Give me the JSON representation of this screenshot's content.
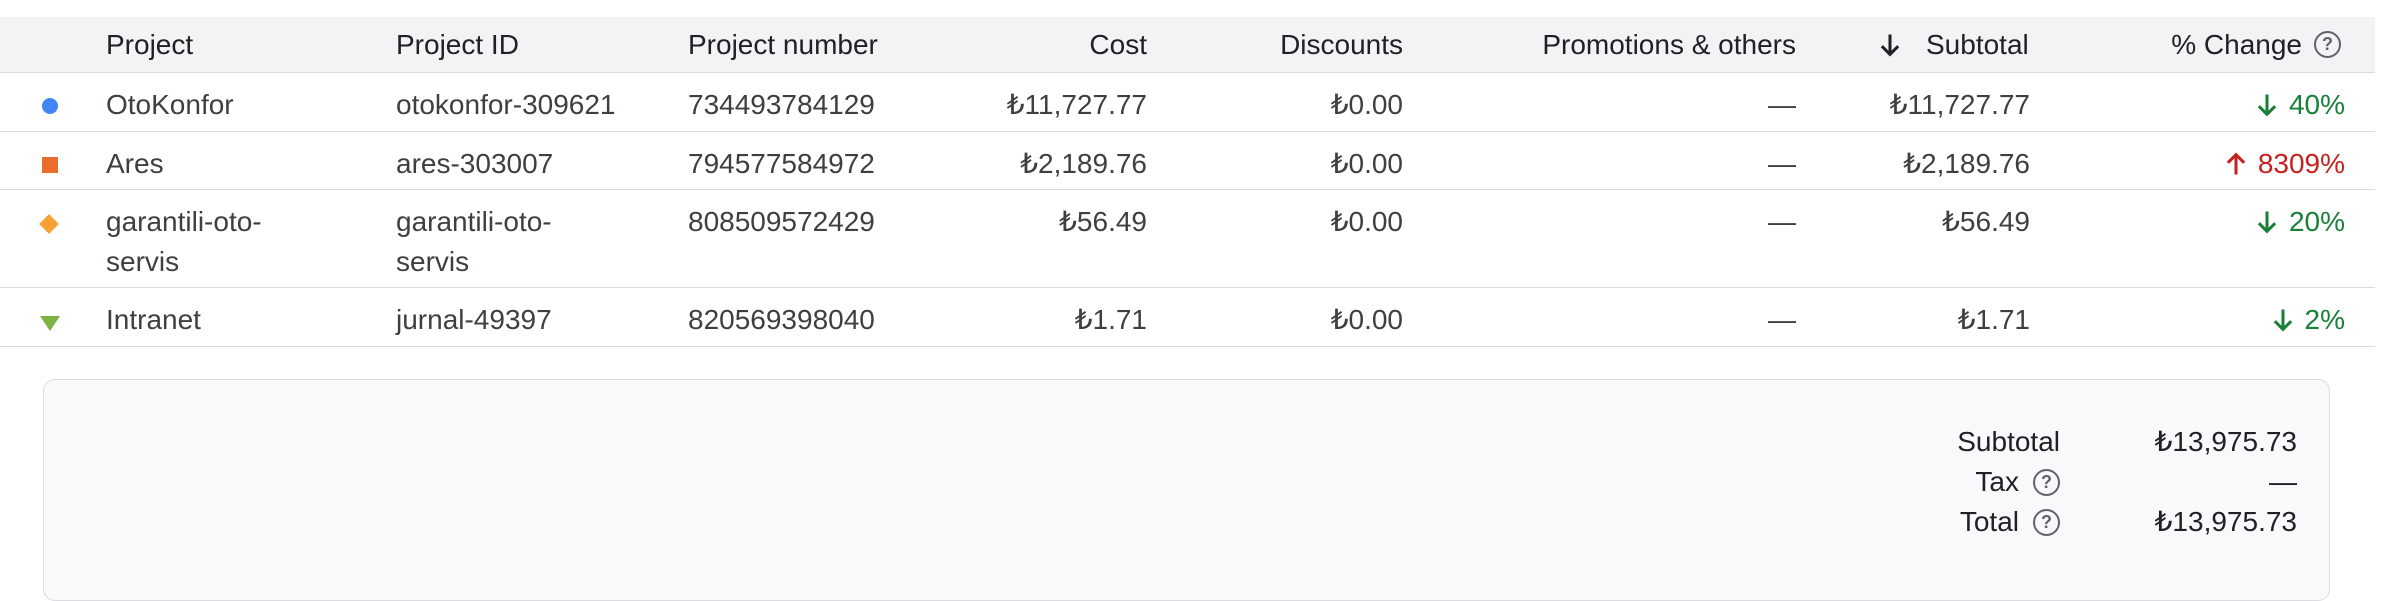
{
  "columns": {
    "project": "Project",
    "project_id": "Project ID",
    "project_number": "Project number",
    "cost": "Cost",
    "discounts": "Discounts",
    "promotions": "Promotions & others",
    "subtotal": "Subtotal",
    "change": "% Change"
  },
  "rows": [
    {
      "marker": "circle",
      "marker_color": "#4285f4",
      "project": "OtoKonfor",
      "project_id": "otokonfor-309621",
      "project_number": "734493784129",
      "cost": "₺11,727.77",
      "discounts": "₺0.00",
      "promotions": "—",
      "subtotal": "₺11,727.77",
      "change": "40%",
      "change_dir": "down",
      "change_color": "#188038"
    },
    {
      "marker": "square",
      "marker_color": "#ea6d2b",
      "project": "Ares",
      "project_id": "ares-303007",
      "project_number": "794577584972",
      "cost": "₺2,189.76",
      "discounts": "₺0.00",
      "promotions": "—",
      "subtotal": "₺2,189.76",
      "change": "8309%",
      "change_dir": "up",
      "change_color": "#c5221f"
    },
    {
      "marker": "diamond",
      "marker_color": "#f6a233",
      "project": "garantili-oto-servis",
      "project_id": "garantili-oto-servis",
      "project_number": "808509572429",
      "cost": "₺56.49",
      "discounts": "₺0.00",
      "promotions": "—",
      "subtotal": "₺56.49",
      "change": "20%",
      "change_dir": "down",
      "change_color": "#188038"
    },
    {
      "marker": "triangle",
      "marker_color": "#7cb342",
      "project": "Intranet",
      "project_id": "jurnal-49397",
      "project_number": "820569398040",
      "cost": "₺1.71",
      "discounts": "₺0.00",
      "promotions": "—",
      "subtotal": "₺1.71",
      "change": "2%",
      "change_dir": "down",
      "change_color": "#188038"
    }
  ],
  "summary": {
    "subtotal_label": "Subtotal",
    "subtotal_value": "₺13,975.73",
    "tax_label": "Tax",
    "tax_value": "—",
    "total_label": "Total",
    "total_value": "₺13,975.73"
  },
  "icons": {
    "sort": "arrow-down-icon",
    "help": "help-circle-icon"
  }
}
